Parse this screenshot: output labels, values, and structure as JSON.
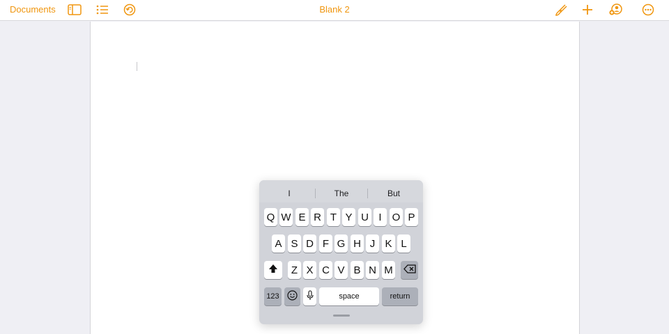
{
  "toolbar": {
    "documents_label": "Documents",
    "title": "Blank 2",
    "icons": [
      "sidebar-icon",
      "list-icon",
      "undo-icon",
      "paintbrush-icon",
      "plus-icon",
      "collaborate-icon",
      "more-icon"
    ],
    "accent_color": "#f0960f"
  },
  "keyboard": {
    "predictions": [
      "I",
      "The",
      "But"
    ],
    "row1": [
      "Q",
      "W",
      "E",
      "R",
      "T",
      "Y",
      "U",
      "I",
      "O",
      "P"
    ],
    "row2": [
      "A",
      "S",
      "D",
      "F",
      "G",
      "H",
      "J",
      "K",
      "L"
    ],
    "row3": [
      "Z",
      "X",
      "C",
      "V",
      "B",
      "N",
      "M"
    ],
    "numbers_label": "123",
    "space_label": "space",
    "return_label": "return",
    "special_icons": [
      "shift-icon",
      "delete-icon",
      "emoji-icon",
      "microphone-icon"
    ]
  }
}
